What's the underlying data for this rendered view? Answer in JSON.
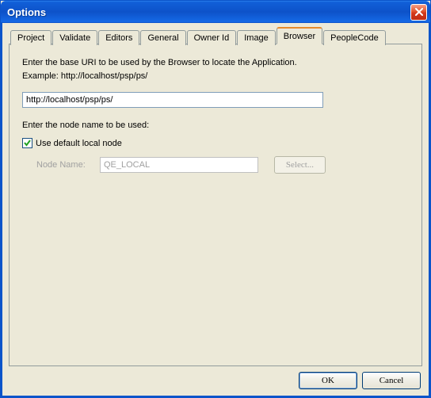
{
  "window": {
    "title": "Options"
  },
  "tabs": {
    "items": [
      {
        "label": "Project"
      },
      {
        "label": "Validate"
      },
      {
        "label": "Editors"
      },
      {
        "label": "General"
      },
      {
        "label": "Owner Id"
      },
      {
        "label": "Image"
      },
      {
        "label": "Browser"
      },
      {
        "label": "PeopleCode"
      }
    ],
    "active_index": 6
  },
  "browser_tab": {
    "instruction_line1": "Enter the base URI to be used by the Browser to locate the Application.",
    "instruction_line2": "Example:  http://localhost/psp/ps/",
    "uri_value": "http://localhost/psp/ps/",
    "node_section_label": "Enter the node name to be used:",
    "use_default_label": "Use default local node",
    "use_default_checked": true,
    "node_name_label": "Node Name:",
    "node_name_value": "QE_LOCAL",
    "select_button_label": "Select..."
  },
  "footer": {
    "ok_label": "OK",
    "cancel_label": "Cancel"
  }
}
